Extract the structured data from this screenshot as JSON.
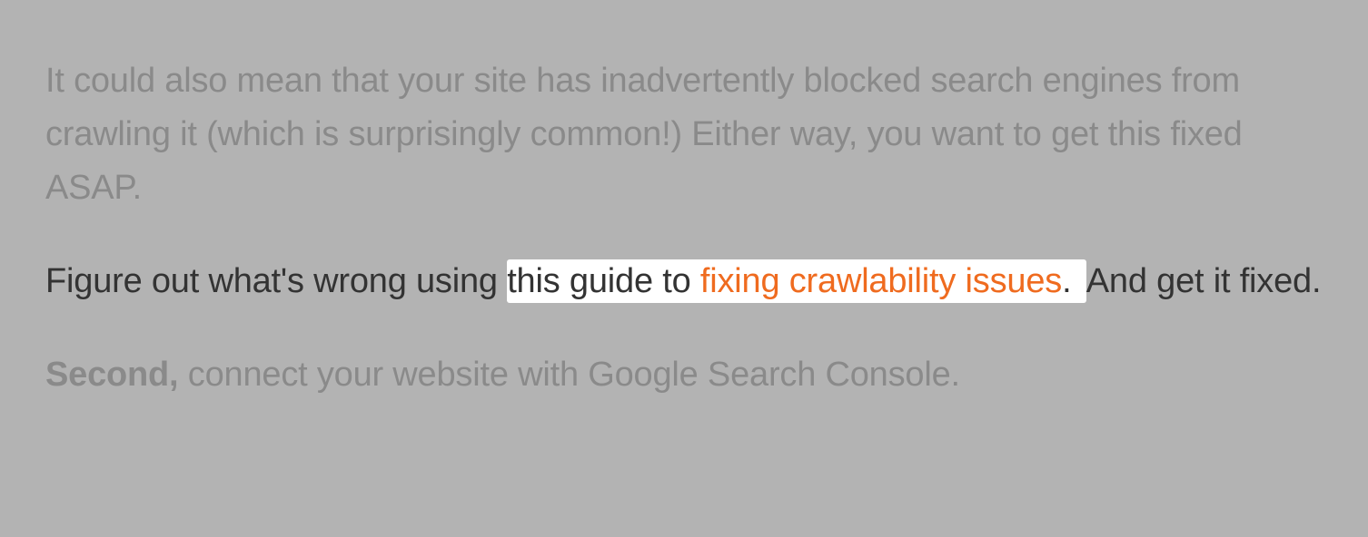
{
  "para1": {
    "text": "It could also mean that your site has inadvertently blocked search engines from crawling it (which is surprisingly common!) Either way, you want to get this fixed ASAP."
  },
  "para2": {
    "prefix": "Figure out what's wrong using ",
    "highlight_before_link": "this guide to ",
    "link_text": "fixing crawlability issues",
    "highlight_after_link": ". ",
    "suffix": "And get it fixed."
  },
  "para3": {
    "bold": "Second,",
    "rest": " connect your website with Google Search Console."
  }
}
